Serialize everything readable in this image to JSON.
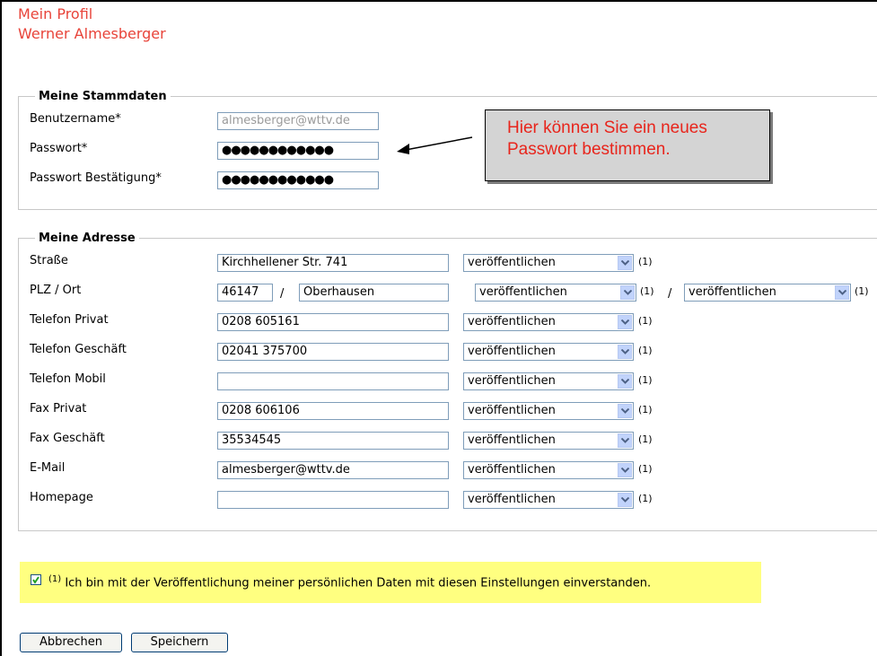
{
  "header": {
    "title": "Mein Profil",
    "name": "Werner Almesberger"
  },
  "stammdaten": {
    "legend": "Meine Stammdaten",
    "username_label": "Benutzername*",
    "username_value": "almesberger@wttv.de",
    "password_label": "Passwort*",
    "password_value": "●●●●●●●●●●●●",
    "password_confirm_label": "Passwort Bestätigung*",
    "password_confirm_value": "●●●●●●●●●●●●"
  },
  "callout": {
    "line1": "Hier können Sie ein neues",
    "line2": "Passwort bestimmen."
  },
  "adresse": {
    "legend": "Meine Adresse",
    "publish_option": "veröffentlichen",
    "footnote": "(1)",
    "rows": [
      {
        "label": "Straße",
        "value": "Kirchhellener Str. 741"
      },
      {
        "label": "PLZ / Ort",
        "zip": "46147",
        "slash": "/",
        "city": "Oberhausen"
      },
      {
        "label": "Telefon Privat",
        "value": "0208 605161"
      },
      {
        "label": "Telefon Geschäft",
        "value": "02041 375700"
      },
      {
        "label": "Telefon Mobil",
        "value": ""
      },
      {
        "label": "Fax Privat",
        "value": "0208 606106"
      },
      {
        "label": "Fax Geschäft",
        "value": "35534545"
      },
      {
        "label": "E-Mail",
        "value": "almesberger@wttv.de"
      },
      {
        "label": "Homepage",
        "value": ""
      }
    ]
  },
  "consent": {
    "checked": true,
    "sup": "(1)",
    "text": "Ich bin mit der Veröffentlichung meiner persönlichen Daten  mit diesen Einstellungen einverstanden."
  },
  "buttons": {
    "cancel": "Abbrechen",
    "save": "Speichern"
  },
  "colors": {
    "title": "#e8443a",
    "callout_text": "#e8251c",
    "consent_bg": "#ffff80"
  }
}
